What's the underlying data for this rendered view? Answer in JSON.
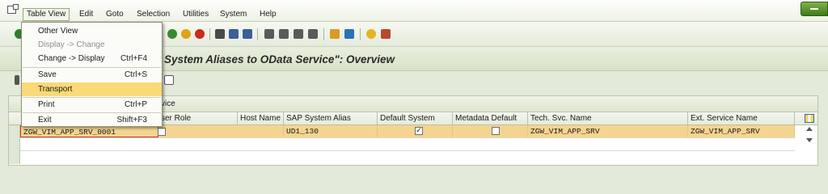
{
  "menu_bar": {
    "items": [
      "Table View",
      "Edit",
      "Goto",
      "Selection",
      "Utilities",
      "System",
      "Help"
    ]
  },
  "title": {
    "text": "System Aliases to OData Service\": Overview"
  },
  "dropdown": {
    "items": [
      {
        "label": "Other View",
        "shortcut": "",
        "disabled": false
      },
      {
        "label": "Display -> Change",
        "shortcut": "",
        "disabled": true
      },
      {
        "label": "Change -> Display",
        "shortcut": "Ctrl+F4",
        "disabled": false
      },
      {
        "label": "Save",
        "shortcut": "Ctrl+S",
        "disabled": false
      },
      {
        "label": "Transport",
        "shortcut": "",
        "disabled": false,
        "highlighted": true
      },
      {
        "label": "Print",
        "shortcut": "Ctrl+P",
        "disabled": false
      },
      {
        "label": "Exit",
        "shortcut": "Shift+F3",
        "disabled": false
      }
    ]
  },
  "table": {
    "caption": "vice",
    "columns": [
      "ser Role",
      "Host Name",
      "SAP System Alias",
      "Default System",
      "Metadata Default",
      "Tech. Svc. Name",
      "Ext. Service Name"
    ],
    "rows": [
      {
        "service_id": "ZGW_VIM_APP_SRV_0001",
        "user_role": "",
        "host_name": "",
        "sap_system_alias": "UD1_130",
        "default_system": true,
        "metadata_default": false,
        "tech_svc_name": "ZGW_VIM_APP_SRV",
        "ext_service_name": "ZGW_VIM_APP_SRV"
      }
    ]
  },
  "colors": {
    "selected_row": "#f5d48f",
    "menu_highlight": "#f9d978",
    "exit_button": "#4f8a24"
  }
}
